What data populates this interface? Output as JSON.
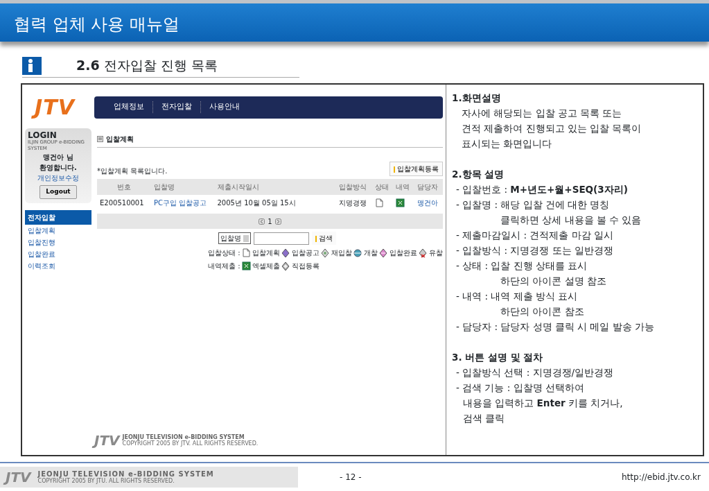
{
  "header": {
    "title": "협력 업체 사용 매뉴얼"
  },
  "section": {
    "number": "2.6",
    "title": "전자입찰 진행 목록"
  },
  "app": {
    "logo": "JTV",
    "nav": [
      {
        "label": "업체정보"
      },
      {
        "label": "전자입찰"
      },
      {
        "label": "사용안내"
      }
    ],
    "login": {
      "title": "LOGIN",
      "subtitle": "ILJIN GROUP e-BIDDING SYSTEM",
      "user": "맹건아 님",
      "welcome": "환영합니다.",
      "profile_link": "개인정보수정",
      "logout": "Logout"
    },
    "menu": {
      "heading": "전자입찰",
      "items": [
        "입찰계획",
        "입찰진행",
        "입찰완료",
        "이력조회"
      ]
    },
    "page_title": "입찰계획",
    "intro": "*입찰계획 목록입니다.",
    "register_button": "입찰계획등록",
    "table": {
      "columns": [
        "번호",
        "입찰명",
        "제출시작일시",
        "입찰방식",
        "상태",
        "내역",
        "담당자"
      ],
      "rows": [
        {
          "number": "E200510001",
          "name": "PC구입 입찰공고",
          "start": "2005년 10월 05일 15시",
          "method": "지명경쟁",
          "status": {
            "kind": "plan"
          },
          "detail": {
            "kind": "excel"
          },
          "manager": "맹건아"
        }
      ]
    },
    "pagination": {
      "page": "1"
    },
    "search": {
      "field": "입찰명",
      "button": "검색"
    },
    "legends": [
      {
        "label": "입찰상태 :",
        "items": [
          {
            "kind": "plan",
            "label": "입찰계획"
          },
          {
            "kind": "notice",
            "label": "입찰공고"
          },
          {
            "kind": "rebid",
            "label": "재입찰"
          },
          {
            "kind": "open",
            "label": "개찰"
          },
          {
            "kind": "complete",
            "label": "입찰완료"
          },
          {
            "kind": "failed",
            "label": "유찰"
          }
        ]
      },
      {
        "label": "내역제출 :",
        "items": [
          {
            "kind": "excel",
            "label": "엑셀제출"
          },
          {
            "kind": "direct",
            "label": "직접등록"
          }
        ]
      }
    ],
    "footer": {
      "logo": "JTV",
      "brand": "JEONJU TELEVISION e-BIDDING SYSTEM",
      "copyright": "COPYRIGHT 2005 BY JTV. ALL RIGHTS RESERVED."
    }
  },
  "description": [
    {
      "kind": "paragraph",
      "heading": "1.화면설명",
      "items": [
        {
          "text": "자사에 해당되는 입찰 공고 목록 또는"
        },
        {
          "text": "견적 제출하여 진행되고 있는 입찰 목록이"
        },
        {
          "text": "표시되는 화면입니다"
        }
      ]
    },
    {
      "kind": "items",
      "heading": "2.항목 설명",
      "items": [
        {
          "text": "- 입찰번호  : **M+년도+월+SEQ(3자리)**"
        },
        {
          "text": "- 입찰명 : 해당 입찰 건에 대한 명칭",
          "children": [
            "클릭하면 상세 내용을 볼 수 있음"
          ]
        },
        {
          "text": "- 제출마감일시 : 견적제출 마감 일시"
        },
        {
          "text": "- 입찰방식 : 지명경쟁 또는 일반경쟁"
        },
        {
          "text": "- 상태 : 입찰 진행 상태를 표시",
          "children": [
            "하단의 아이콘 설명 참조"
          ]
        },
        {
          "text": "- 내역 : 내역 제출 방식 표시",
          "children": [
            "하단의 아이콘 참조"
          ]
        },
        {
          "text": "- 담당자 : 담당자 성명 클릭 시 메일 발송 가능"
        }
      ]
    },
    {
      "kind": "steps",
      "heading": "3. 버튼 설명 및 절차",
      "items": [
        {
          "text": "- 입찰방식 선택 : 지명경쟁/일반경쟁"
        },
        {
          "text": "- 검색 기능 : 입찰명 선택하여",
          "children": [
            "내용을 입력하고 **Enter** 키를 치거나,",
            "검색 클릭"
          ]
        }
      ]
    }
  ],
  "footer": {
    "logo": "JTV",
    "brand": "JEONJU TELEVISION e-BIDDING SYSTEM",
    "copyright": "COPYRIGHT 2005 BY JTU. ALL RIGHTS RESERVED.",
    "page": "- 12 -",
    "url": "http://ebid.jtv.co.kr"
  }
}
